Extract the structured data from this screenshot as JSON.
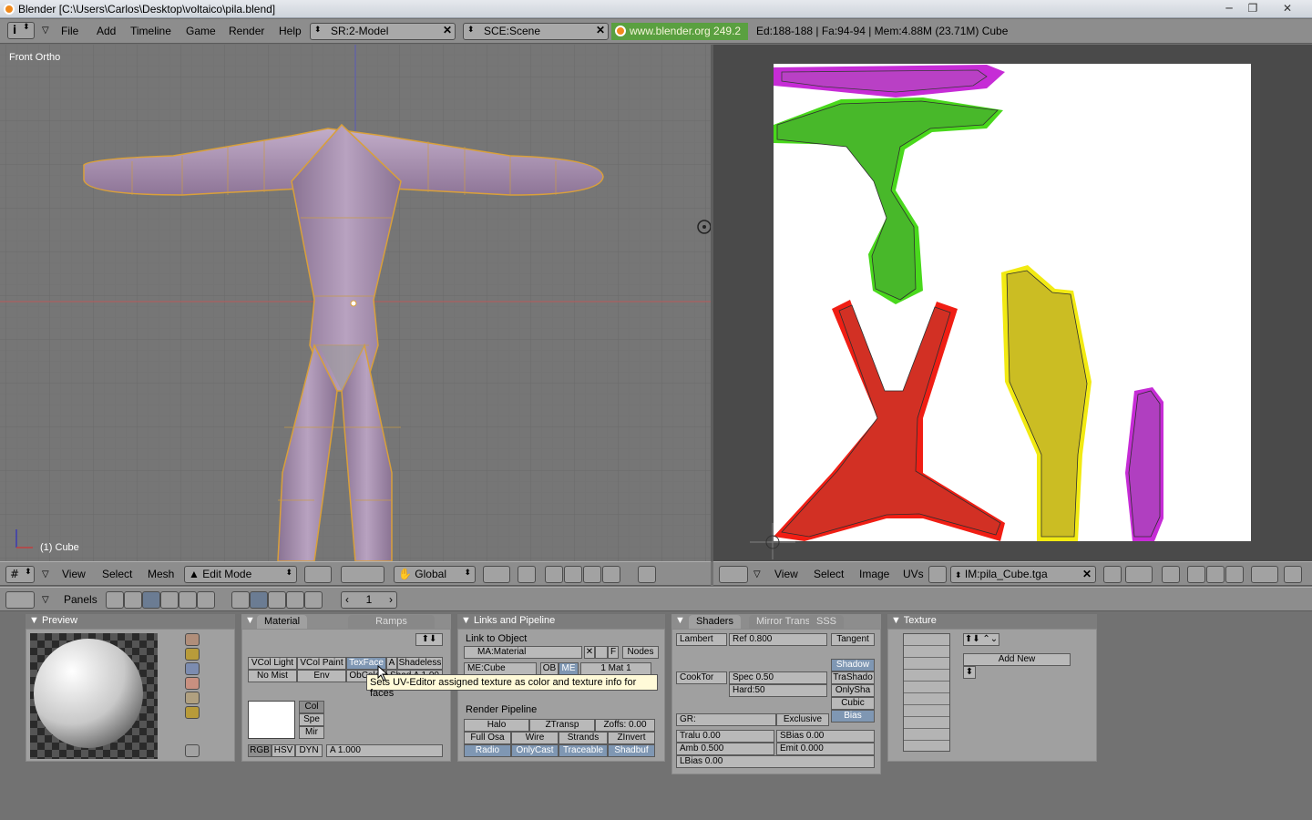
{
  "window": {
    "title": "Blender [C:\\Users\\Carlos\\Desktop\\voltaico\\pila.blend]",
    "minimize": "─",
    "maximize": "❐",
    "close": "✕"
  },
  "menubar": {
    "items": [
      "File",
      "Add",
      "Timeline",
      "Game",
      "Render",
      "Help"
    ],
    "screen": "SR:2-Model",
    "scene": "SCE:Scene",
    "url": "www.blender.org 249.2",
    "stats": "Ed:188-188 | Fa:94-94 | Mem:4.88M (23.71M) Cube"
  },
  "view3d": {
    "view_label": "Front Ortho",
    "object_label": "(1) Cube",
    "header": {
      "menus": [
        "View",
        "Select",
        "Mesh"
      ],
      "mode": "Edit Mode",
      "orientation": "Global"
    }
  },
  "uv_editor": {
    "header": {
      "menus": [
        "View",
        "Select",
        "Image",
        "UVs"
      ],
      "image": "IM:pila_Cube.tga"
    }
  },
  "buttons_header": {
    "panels_label": "Panels",
    "frame": "1"
  },
  "preview_panel": {
    "title": "Preview"
  },
  "material_panel": {
    "tabs": [
      "Material",
      "Ramps"
    ],
    "row1": [
      "VCol Light",
      "VCol Paint",
      "TexFace",
      "A",
      "Shadeless"
    ],
    "row2": [
      "No Mist",
      "Env",
      "ObColor",
      "Shad A 1.00"
    ],
    "color_buttons": [
      "Col",
      "Spe",
      "Mir"
    ],
    "mode_buttons": [
      "RGB",
      "HSV",
      "DYN"
    ],
    "alpha": "A 1.000"
  },
  "tooltip": "Sets UV-Editor assigned texture as color and texture info for faces",
  "links_panel": {
    "title": "Links and Pipeline",
    "link_label": "Link to Object",
    "material": "MA:Material",
    "f_label": "F",
    "nodes": "Nodes",
    "mesh": "ME:Cube",
    "ob": "OB",
    "me": "ME",
    "mat_index": "1 Mat 1",
    "pipeline_label": "Render Pipeline",
    "pipe_row1": [
      "Halo",
      "ZTransp",
      "Zoffs: 0.00"
    ],
    "pipe_row2": [
      "Full Osa",
      "Wire",
      "Strands",
      "ZInvert"
    ],
    "pipe_row3": [
      "Radio",
      "OnlyCast",
      "Traceable",
      "Shadbuf"
    ]
  },
  "shaders_panel": {
    "tabs": [
      "Shaders",
      "Mirror Trans",
      "SSS"
    ],
    "diffuse": "Lambert",
    "ref": "Ref 0.800",
    "tangent": "Tangent",
    "specular": "CookTor",
    "spec": "Spec 0.50",
    "hard": "Hard:50",
    "toggles": [
      "Shadow",
      "TraShado",
      "OnlySha",
      "Cubic",
      "Bias"
    ],
    "gr": "GR:",
    "exclusive": "Exclusive",
    "tralu": "Tralu 0.00",
    "sbias": "SBias 0.00",
    "amb": "Amb 0.500",
    "emit": "Emit 0.000",
    "lbias": "LBias 0.00"
  },
  "texture_panel": {
    "title": "Texture",
    "add_new": "Add New"
  }
}
